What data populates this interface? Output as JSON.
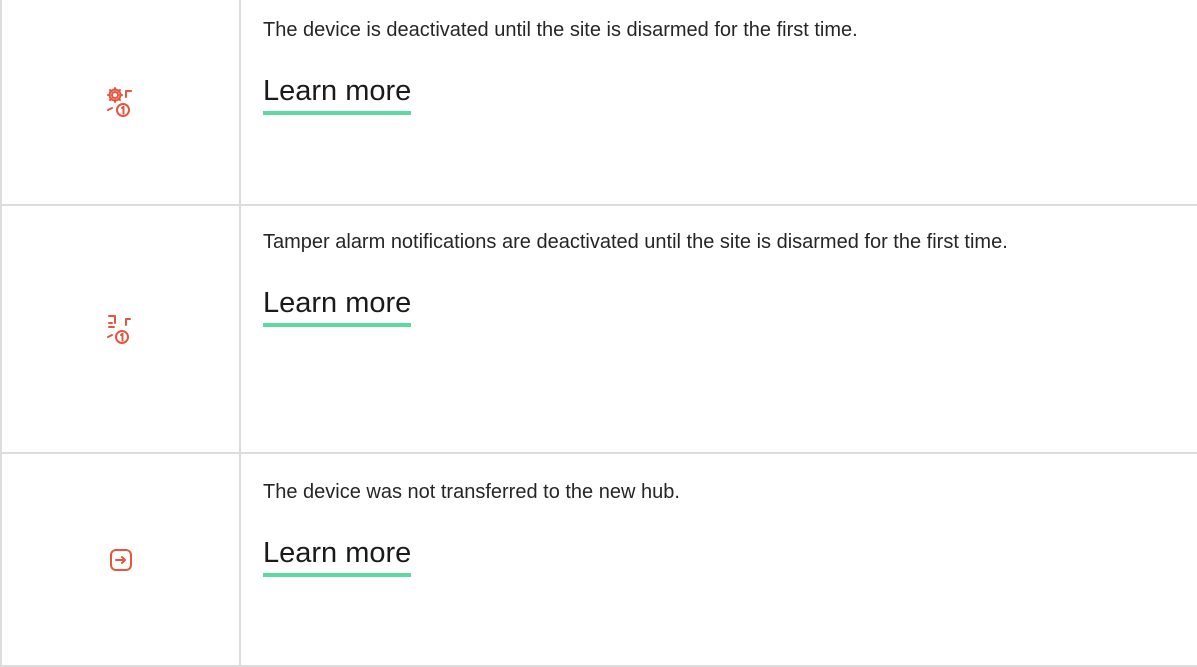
{
  "rows": [
    {
      "icon": "gear-arrow-one-icon",
      "description": "The device is deactivated until the site is disarmed for the first time.",
      "link_label": "Learn more"
    },
    {
      "icon": "tamper-arrow-one-icon",
      "description": "Tamper alarm notifications are deactivated until the site is disarmed for the first time.",
      "link_label": "Learn more"
    },
    {
      "icon": "transfer-arrow-box-icon",
      "description": "The device was not transferred to the new hub.",
      "link_label": "Learn more"
    }
  ],
  "colors": {
    "icon": "#e8553f",
    "link_underline": "#5ed9a2",
    "border": "#dcdcdc",
    "text": "#262626"
  }
}
